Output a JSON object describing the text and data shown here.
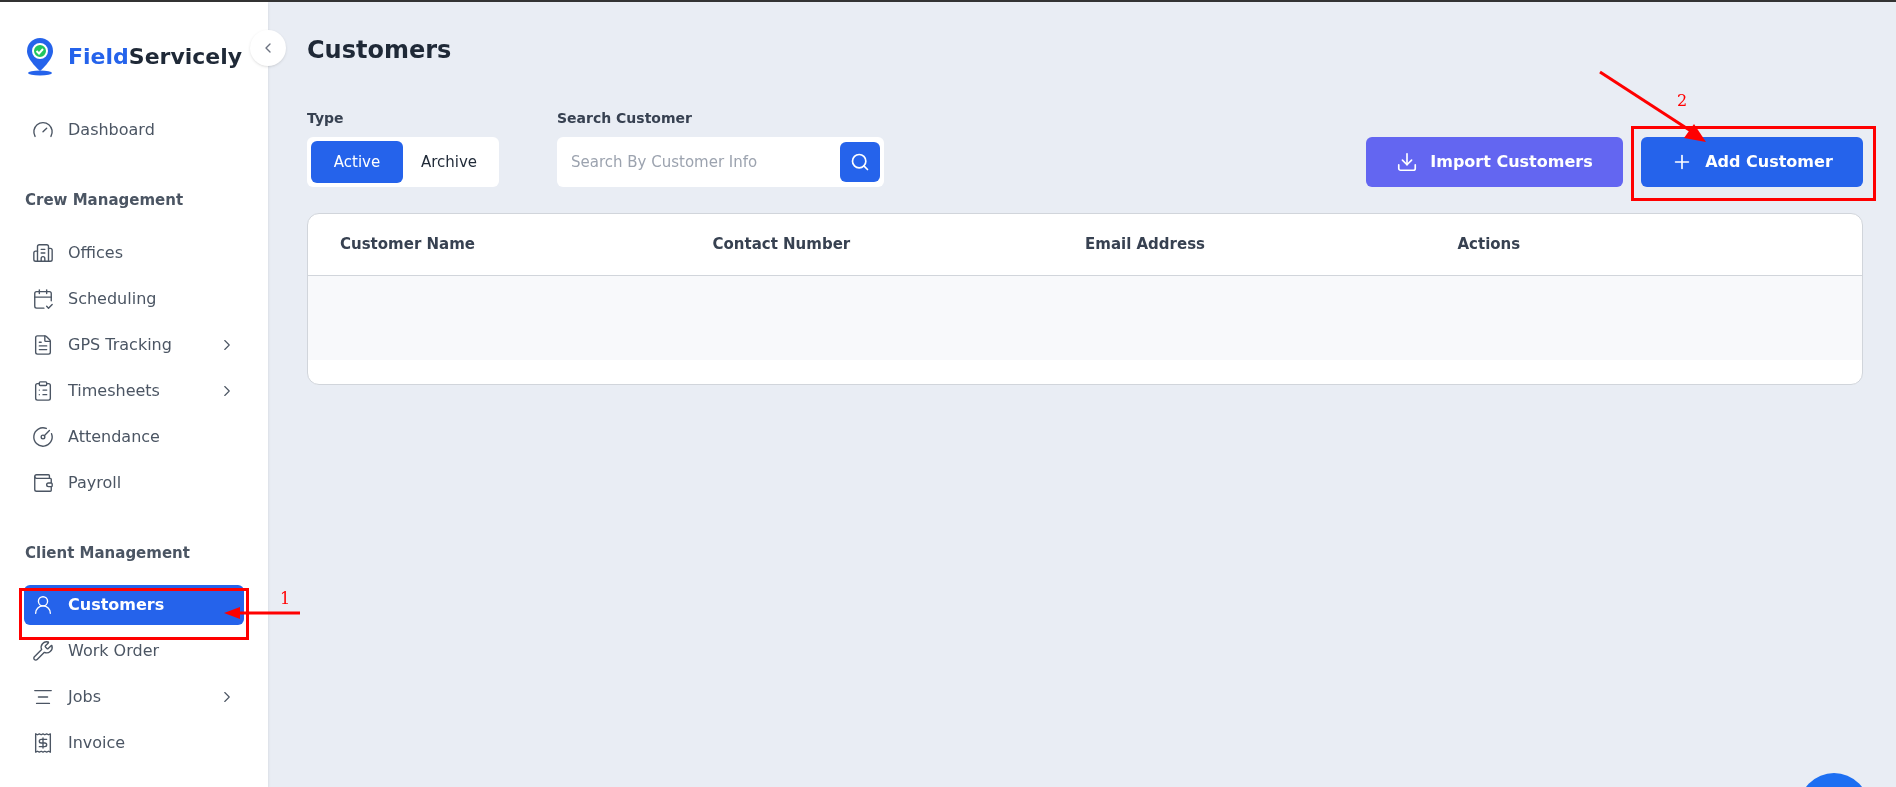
{
  "brand": {
    "first": "Field",
    "second": "Servicely"
  },
  "sidebar": {
    "sections": [
      {
        "items": [
          {
            "label": "Dashboard",
            "selected": false,
            "expandable": false
          }
        ]
      },
      {
        "heading": "Crew Management",
        "items": [
          {
            "label": "Offices",
            "selected": false,
            "expandable": false
          },
          {
            "label": "Scheduling",
            "selected": false,
            "expandable": false
          },
          {
            "label": "GPS Tracking",
            "selected": false,
            "expandable": true
          },
          {
            "label": "Timesheets",
            "selected": false,
            "expandable": true
          },
          {
            "label": "Attendance",
            "selected": false,
            "expandable": false
          },
          {
            "label": "Payroll",
            "selected": false,
            "expandable": false
          }
        ]
      },
      {
        "heading": "Client Management",
        "items": [
          {
            "label": "Customers",
            "selected": true,
            "expandable": false
          },
          {
            "label": "Work Order",
            "selected": false,
            "expandable": false
          },
          {
            "label": "Jobs",
            "selected": false,
            "expandable": true
          },
          {
            "label": "Invoice",
            "selected": false,
            "expandable": false
          }
        ]
      }
    ]
  },
  "page_title": "Customers",
  "type_filter": {
    "label": "Type",
    "options": [
      {
        "label": "Active",
        "selected": true
      },
      {
        "label": "Archive",
        "selected": false
      }
    ]
  },
  "search": {
    "label": "Search Customer",
    "placeholder": "Search By Customer Info"
  },
  "buttons": [
    {
      "label": "Import Customers",
      "kind": "import"
    },
    {
      "label": "Add Customer",
      "kind": "add"
    }
  ],
  "table": {
    "columns": [
      "Customer Name",
      "Contact Number",
      "Email Address",
      "Actions"
    ]
  },
  "annotations": [
    {
      "number": "1"
    },
    {
      "number": "2"
    }
  ]
}
